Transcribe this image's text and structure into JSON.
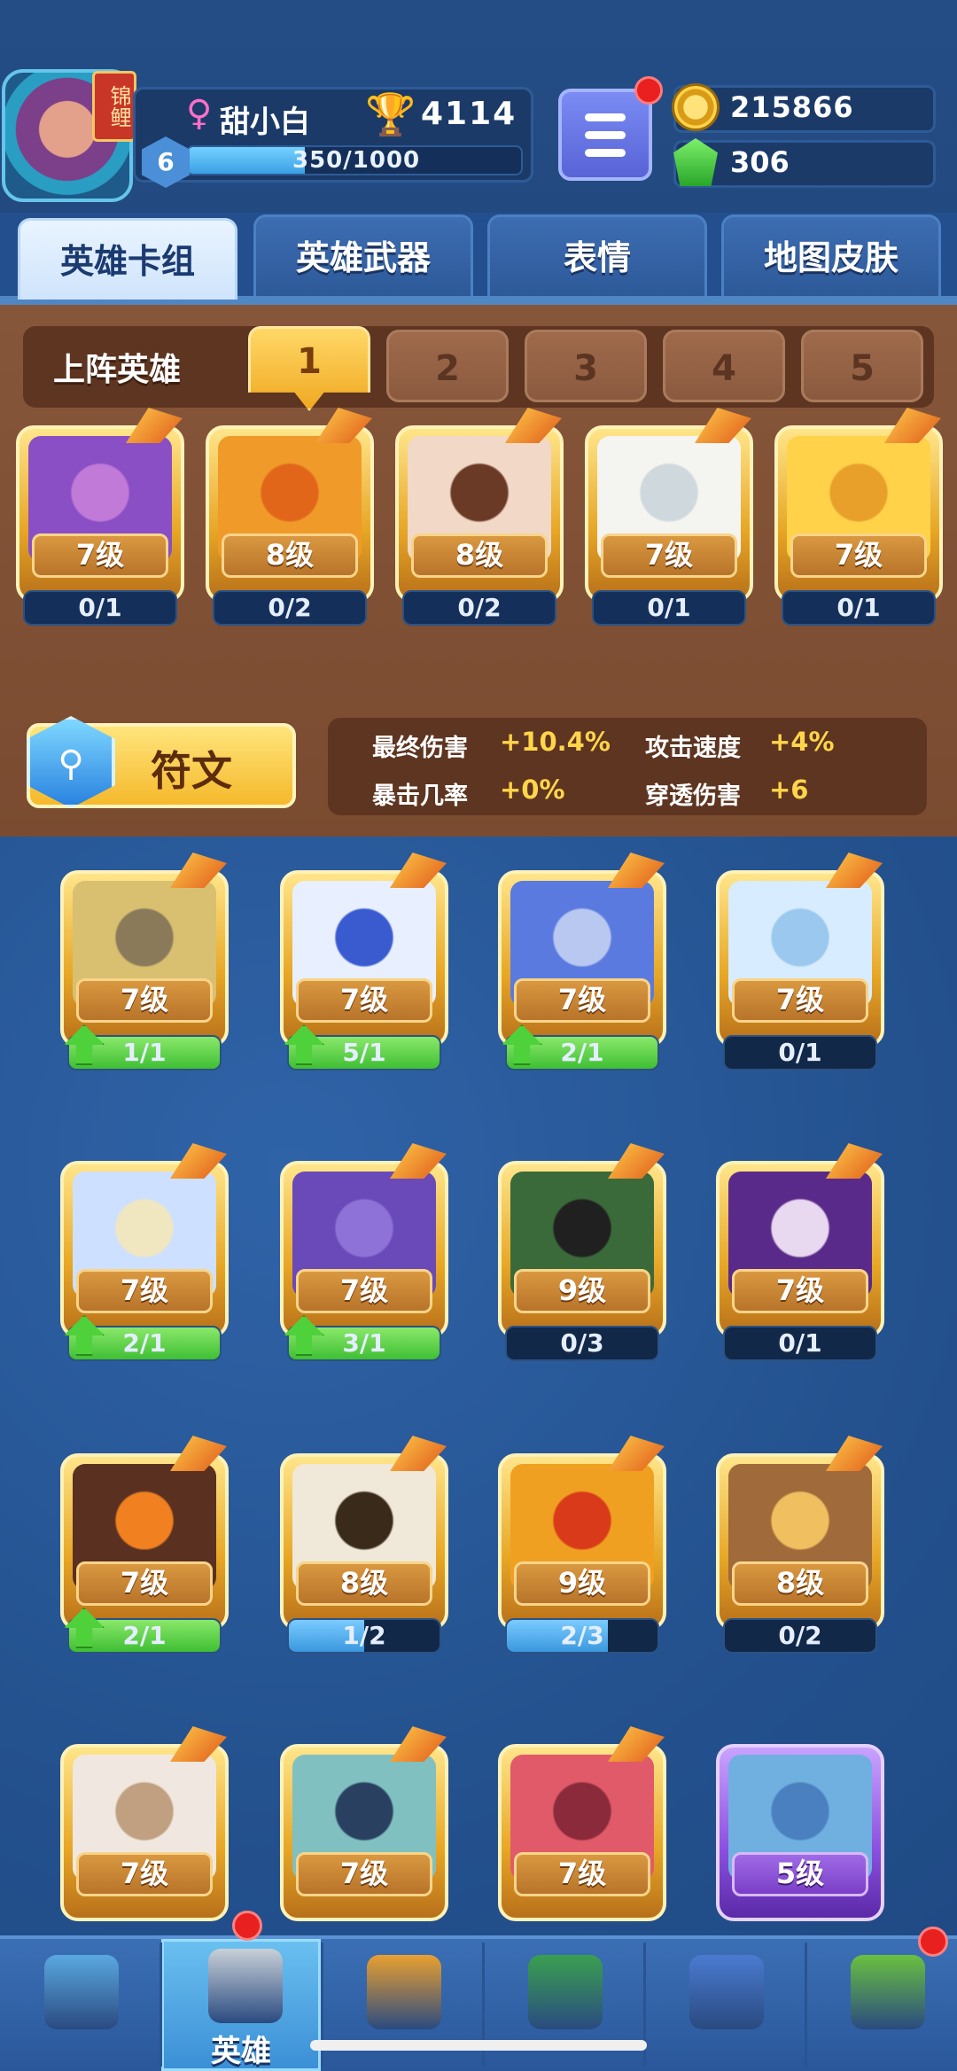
{
  "player": {
    "name": "甜小白",
    "avatar_badge": "锦鲤",
    "level": "6",
    "xp_text": "350/1000",
    "xp_fraction": 0.35,
    "trophies": "4114",
    "gender_icon": "female-icon"
  },
  "currency": {
    "coins": "215866",
    "gems": "306"
  },
  "tabs": [
    {
      "label": "英雄卡组",
      "active": true
    },
    {
      "label": "英雄武器",
      "active": false
    },
    {
      "label": "表情",
      "active": false
    },
    {
      "label": "地图皮肤",
      "active": false
    }
  ],
  "deck": {
    "label": "上阵英雄",
    "slots": [
      "1",
      "2",
      "3",
      "4",
      "5"
    ],
    "active_slot": "1",
    "heroes": [
      {
        "level": "7级",
        "count": "0/1",
        "progress": 0
      },
      {
        "level": "8级",
        "count": "0/2",
        "progress": 0
      },
      {
        "level": "8级",
        "count": "0/2",
        "progress": 0
      },
      {
        "level": "7级",
        "count": "0/1",
        "progress": 0
      },
      {
        "level": "7级",
        "count": "0/1",
        "progress": 0
      }
    ]
  },
  "runes": {
    "button_label": "符文",
    "stats": [
      {
        "label": "最终伤害",
        "value": "+10.4%"
      },
      {
        "label": "攻击速度",
        "value": "+4%"
      },
      {
        "label": "暴击几率",
        "value": "+0%"
      },
      {
        "label": "穿透伤害",
        "value": "+6"
      }
    ]
  },
  "collection": [
    {
      "level": "7级",
      "count": "1/1",
      "progress": 1,
      "upgrade": true
    },
    {
      "level": "7级",
      "count": "5/1",
      "progress": 1,
      "upgrade": true
    },
    {
      "level": "7级",
      "count": "2/1",
      "progress": 1,
      "upgrade": true
    },
    {
      "level": "7级",
      "count": "0/1",
      "progress": 0,
      "upgrade": false
    },
    {
      "level": "7级",
      "count": "2/1",
      "progress": 1,
      "upgrade": true
    },
    {
      "level": "7级",
      "count": "3/1",
      "progress": 1,
      "upgrade": true
    },
    {
      "level": "9级",
      "count": "0/3",
      "progress": 0,
      "upgrade": false
    },
    {
      "level": "7级",
      "count": "0/1",
      "progress": 0,
      "upgrade": false
    },
    {
      "level": "7级",
      "count": "2/1",
      "progress": 1,
      "upgrade": true
    },
    {
      "level": "8级",
      "count": "1/2",
      "progress": 0.5,
      "upgrade": false
    },
    {
      "level": "9级",
      "count": "2/3",
      "progress": 0.67,
      "upgrade": false
    },
    {
      "level": "8级",
      "count": "0/2",
      "progress": 0,
      "upgrade": false
    },
    {
      "level": "7级",
      "count": "",
      "progress": 0,
      "upgrade": false
    },
    {
      "level": "7级",
      "count": "",
      "progress": 0,
      "upgrade": false
    },
    {
      "level": "7级",
      "count": "",
      "progress": 0,
      "upgrade": false
    },
    {
      "level": "5级",
      "count": "",
      "progress": 0,
      "upgrade": false,
      "rarity": "purple"
    }
  ],
  "bottom_nav": [
    {
      "label": "",
      "icon": "treasure-chest-icon",
      "active": false
    },
    {
      "label": "英雄",
      "icon": "knight-helmet-icon",
      "active": true
    },
    {
      "label": "",
      "icon": "crossed-swords-icon",
      "active": false
    },
    {
      "label": "",
      "icon": "crown-shield-icon",
      "active": false
    },
    {
      "label": "",
      "icon": "friends-banner-icon",
      "active": false
    },
    {
      "label": "",
      "icon": "sprout-island-icon",
      "active": false
    }
  ],
  "colors": {
    "background": "#234f8e",
    "deck_wood": "#7a4b30",
    "gold": "#f0a922",
    "upgrade_green": "#4fd13b",
    "progress_blue": "#4aaee8"
  }
}
